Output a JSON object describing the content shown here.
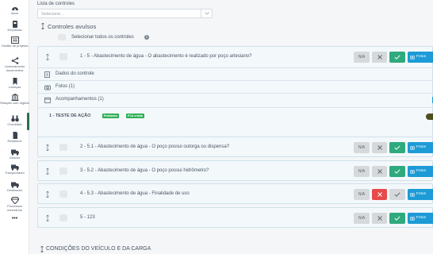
{
  "sidebar": {
    "items": [
      {
        "label": "Início",
        "icon": "dashboard-icon"
      },
      {
        "label": "Empresas",
        "icon": "building-icon"
      },
      {
        "label": "Gestão de projetos",
        "icon": "kanban-icon"
      },
      {
        "label": "Licenciamento documentos",
        "icon": "branch-icon"
      },
      {
        "label": "Licenças",
        "icon": "bookmark-icon"
      },
      {
        "label": "Relação com órgãos",
        "icon": "institution-icon"
      },
      {
        "label": "Checklists",
        "icon": "binoculars-icon"
      },
      {
        "label": "Relatórios",
        "icon": "file-icon"
      },
      {
        "label": "Geador",
        "icon": "truck-icon"
      },
      {
        "label": "Transportador",
        "icon": "truck-icon"
      },
      {
        "label": "Destinador",
        "icon": "truck-icon"
      },
      {
        "label": "Processos minerários",
        "icon": "gem-icon"
      },
      {
        "label": "•••",
        "icon": "more-icon"
      }
    ],
    "active": "Checklists"
  },
  "controls": {
    "list_label": "Lista de controles",
    "select_placeholder": "Selecione..."
  },
  "section": {
    "title": "Controles avulsos",
    "select_all": "Selecionar todos os controles"
  },
  "items": [
    {
      "title": "1 - 5 - Abastecimento de água - O abastecimento é realizado por poço artesiano?",
      "na": "N/A",
      "fotos": "Fotos",
      "state": "ok"
    },
    {
      "title": "2 - 5.1 - Abastecimento de água - O poço possui outorga ou dispensa?",
      "na": "N/A",
      "fotos": "Fotos",
      "state": "ok"
    },
    {
      "title": "3 - 5.2 - Abastecimento de água - O poço possui hidrômetro?",
      "na": "N/A",
      "fotos": "Fotos",
      "state": "ok"
    },
    {
      "title": "4 - 5.3 - Abastecimento de água - Finalidade de uso",
      "na": "N/A",
      "fotos": "Fotos",
      "state": "x"
    },
    {
      "title": "5 - 123",
      "na": "N/A",
      "fotos": "Fotos",
      "state": "ok"
    }
  ],
  "expanded": {
    "dados": "Dados do controle",
    "fotos": "Fotos (1)",
    "acompanhamentos": "Acompanhamentos (1)",
    "action_label": "1 - TESTE DE AÇÃO",
    "badge_1": "Realizado",
    "badge_2": "FCA criada"
  },
  "bottom_section_title": "CONDIÇÕES DO VEÍCULO E DA CARGA",
  "colors": {
    "accent_green": "#2faa7e",
    "danger_red": "#e84a4a",
    "info_blue": "#1c9bd6",
    "badge_green": "#2fb055"
  }
}
